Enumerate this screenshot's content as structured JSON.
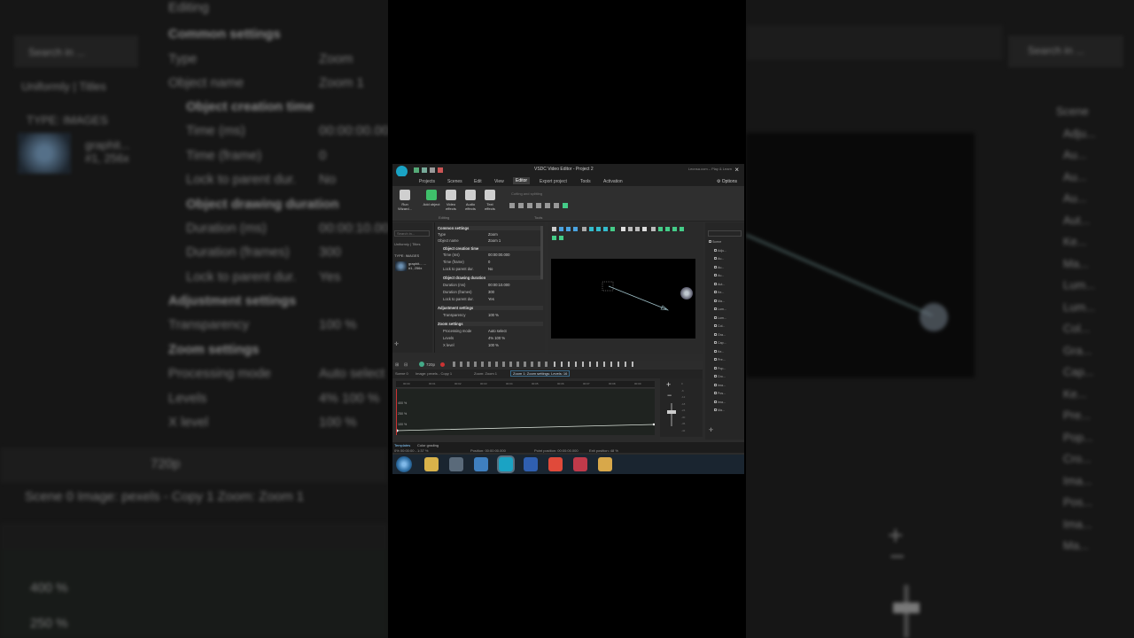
{
  "app": {
    "title": "VSDC Video Editor - Project 2",
    "title_right": "Leonsa.com – Play & Learn",
    "close_glyph": "×",
    "options_label": "Options"
  },
  "menu": {
    "items": [
      "Projects",
      "Scenes",
      "Edit",
      "View",
      "Editor",
      "Export project",
      "Tools",
      "Activation"
    ],
    "active": "Editor"
  },
  "ribbon": {
    "buttons": [
      {
        "label": "Run Wizard...",
        "icon": "wand-icon",
        "color": "#cfcfcf"
      },
      {
        "label": "Add object",
        "icon": "add-object-icon",
        "color": "#3fbf6a"
      },
      {
        "label": "Video effects",
        "icon": "video-effects-icon",
        "color": "#cfcfcf"
      },
      {
        "label": "Audio effects",
        "icon": "audio-effects-icon",
        "color": "#cfcfcf"
      },
      {
        "label": "Text effects",
        "icon": "text-effects-icon",
        "color": "#cfcfcf"
      }
    ],
    "cutting_label": "Cutting and splitting",
    "group_editing": "Editing",
    "group_tools": "Tools"
  },
  "left_panel": {
    "search_placeholder": "Search in...",
    "tabs": "Uniformly | Titles",
    "type_header": "TYPE: IMAGES",
    "item_name": "graphit... ...",
    "item_sub": "#1, 256x"
  },
  "properties": {
    "common_settings": "Common settings",
    "type_label": "Type",
    "type_value": "Zoom",
    "object_name_label": "Object name",
    "object_name_value": "Zoom 1",
    "creation_time": "Object creation time",
    "time_ms_label": "Time (ms)",
    "time_ms_value": "00:00:00.000",
    "time_frame_label": "Time (frame)",
    "time_frame_value": "0",
    "lock_label": "Lock to parent dur.",
    "lock_value": "No",
    "drawing_duration": "Object drawing duration",
    "duration_ms_label": "Duration (ms)",
    "duration_ms_value": "00:00:10.000",
    "duration_frames_label": "Duration (frames)",
    "duration_frames_value": "300",
    "lock2_label": "Lock to parent dur.",
    "lock2_value": "Yes",
    "adjustment_settings": "Adjustment settings",
    "transparency_label": "Transparency",
    "transparency_value": "100 %",
    "zoom_settings": "Zoom settings",
    "processing_label": "Processing mode",
    "processing_value": "Auto select",
    "levels_label": "Levels",
    "levels_value": "4% 100 %",
    "x_level_label": "X level",
    "x_level_value": "100 %"
  },
  "timeline": {
    "tabs": [
      "Scene 0",
      "Image: pexels - Copy 1",
      "Zoom: Zoom 1",
      "Zoom 1: Zoom settings: Levels: 16"
    ],
    "active_tab_index": 3,
    "ruler_marks": [
      "00:00",
      "00:01",
      "00:02",
      "00:03",
      "00:04",
      "00:05",
      "00:06",
      "00:07",
      "00:08",
      "00:09"
    ],
    "graph_labels": [
      "400 %",
      "250 %",
      "100 %"
    ],
    "resolution": "720p"
  },
  "volume": {
    "plus": "+",
    "minus": "−",
    "scale": [
      "0",
      "-6",
      "-12",
      "-18",
      "-24",
      "-30",
      "-36",
      "-42"
    ]
  },
  "status": {
    "tab_templates": "Templates",
    "tab_color": "Color grading",
    "position": "Position:  00:00:00.000",
    "point_position": "Point position:  00:00:00.000",
    "exit_position": "Exit position:  48 %",
    "zoom": "0% 00:00:00 - 1:37 %"
  },
  "taskbar": {
    "apps": [
      {
        "name": "explorer-icon",
        "color": "#d8b24a"
      },
      {
        "name": "media-icon",
        "color": "#5a6a7a"
      },
      {
        "name": "app-q-icon",
        "color": "#3f7fbf"
      },
      {
        "name": "vsdc-icon",
        "color": "#1aa3c4"
      },
      {
        "name": "word-icon",
        "color": "#2f5fb0"
      },
      {
        "name": "chrome-icon",
        "color": "#e04a3a"
      },
      {
        "name": "recorder-icon",
        "color": "#c03a4a"
      },
      {
        "name": "folder-icon",
        "color": "#d8a84a"
      }
    ]
  },
  "background": {
    "left_editing": "Editing",
    "left_common": "Common settings",
    "left_type": "Type",
    "left_type_val": "Zoom",
    "left_objname": "Object name",
    "left_objname_val": "Zoom 1",
    "left_creation": "Object creation time",
    "left_time_ms": "Time (ms)",
    "left_time_ms_val": "00:00:00.00",
    "left_time_frame": "Time (frame)",
    "left_time_frame_val": "0",
    "left_lock": "Lock to parent dur.",
    "left_lock_val": "No",
    "left_drawing": "Object drawing duration",
    "left_dur_ms": "Duration (ms)",
    "left_dur_ms_val": "00:00:10.00",
    "left_dur_frames": "Duration (frames)",
    "left_dur_frames_val": "300",
    "left_lock2": "Lock to parent dur.",
    "left_lock2_val": "Yes",
    "left_adjust": "Adjustment settings",
    "left_transp": "Transparency",
    "left_transp_val": "100 %",
    "left_zoomset": "Zoom settings",
    "left_proc": "Processing mode",
    "left_proc_val": "Auto select",
    "left_levels": "Levels",
    "left_levels_val": "4% 100 %",
    "left_xlevel": "X level",
    "left_xlevel_val": "100 %",
    "left_search": "Search in ...",
    "left_tabs": "Uniformly | Titles",
    "left_typehdr": "TYPE: IMAGES",
    "left_thumb_name": "graphit... #1, 256x",
    "left_scene_tabs": "Scene 0  Image: pexels - Copy 1  Zoom: Zoom 1",
    "left_res": "720p",
    "left_g1": "400 %",
    "left_g2": "250 %",
    "right_search": "Search in ...",
    "right_tree": [
      "Scene",
      "Adju...",
      "Au...",
      "Au...",
      "Au...",
      "Aut...",
      "Ke...",
      "Ma...",
      "Lum...",
      "Lum...",
      "Col...",
      "Gra...",
      "Cap...",
      "Ke...",
      "Pre...",
      "Pop...",
      "Cro...",
      "Ima...",
      "Pos...",
      "Ima...",
      "Ma..."
    ]
  }
}
